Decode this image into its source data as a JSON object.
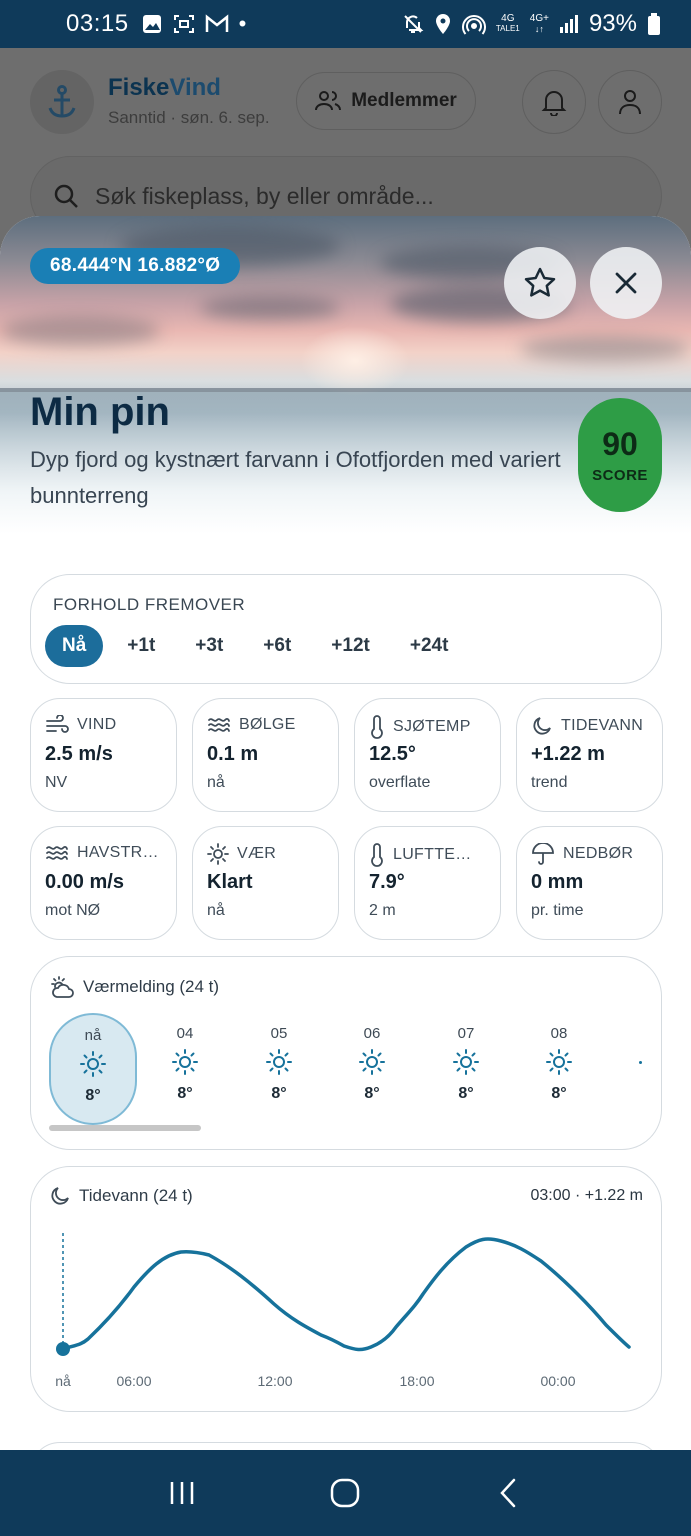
{
  "status_bar": {
    "time": "03:15",
    "battery": "93%",
    "net1": "4G",
    "net1_sub": "TALE1",
    "net2": "4G+"
  },
  "app": {
    "brand_a": "Fiske",
    "brand_b": "Vind",
    "subtitle": "Sanntid · søn. 6. sep.",
    "members_label": "Medlemmer",
    "search_placeholder": "Søk fiskeplass, by eller område..."
  },
  "pin": {
    "coords": "68.444°N 16.882°Ø",
    "title": "Min pin",
    "description": "Dyp fjord og kystnært farvann i Ofotfjorden med variert bunnterreng",
    "score": "90",
    "score_label": "SCORE"
  },
  "forhold": {
    "label": "FORHOLD FREMOVER",
    "tabs": [
      "Nå",
      "+1t",
      "+3t",
      "+6t",
      "+12t",
      "+24t"
    ],
    "active_tab": 0
  },
  "metrics": [
    {
      "label": "VIND",
      "value": "2.5 m/s",
      "sub": "NV",
      "icon": "wind-icon"
    },
    {
      "label": "BØLGE",
      "value": "0.1 m",
      "sub": "nå",
      "icon": "waves-icon"
    },
    {
      "label": "SJØTEMP",
      "value": "12.5°",
      "sub": "overflate",
      "icon": "thermometer-icon"
    },
    {
      "label": "TIDEVANN",
      "value": "+1.22 m",
      "sub": "trend",
      "icon": "moon-icon"
    },
    {
      "label": "HAVSTR…",
      "value": "0.00 m/s",
      "sub": "mot NØ",
      "icon": "current-icon"
    },
    {
      "label": "VÆR",
      "value": "Klart",
      "sub": "nå",
      "icon": "sun-icon"
    },
    {
      "label": "LUFTTE…",
      "value": "7.9°",
      "sub": "2 m",
      "icon": "thermometer-icon"
    },
    {
      "label": "NEDBØR",
      "value": "0 mm",
      "sub": "pr. time",
      "icon": "umbrella-icon"
    }
  ],
  "forecast": {
    "title": "Værmelding (24 t)",
    "hours": [
      {
        "h": "nå",
        "t": "8°"
      },
      {
        "h": "04",
        "t": "8°"
      },
      {
        "h": "05",
        "t": "8°"
      },
      {
        "h": "06",
        "t": "8°"
      },
      {
        "h": "07",
        "t": "8°"
      },
      {
        "h": "08",
        "t": "8°"
      }
    ]
  },
  "tide": {
    "title": "Tidevann (24 t)",
    "readout": "03:00 · +1.22 m",
    "x_labels": [
      "nå",
      "06:00",
      "12:00",
      "18:00",
      "00:00"
    ],
    "color": "#16729b"
  },
  "colors": {
    "accent": "#1c6d9b",
    "score_bg": "#2e9d46",
    "nav": "#0f3a5a"
  }
}
